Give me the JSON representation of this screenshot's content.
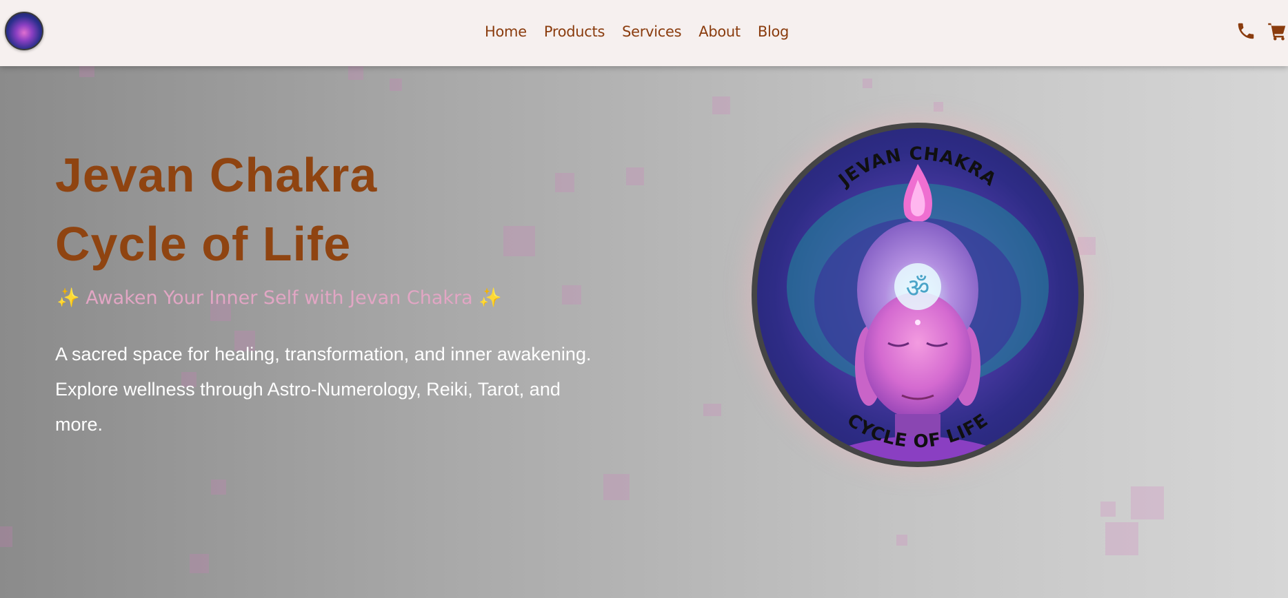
{
  "header": {
    "logo_icon": "jevan-chakra-logo",
    "nav": {
      "home": "Home",
      "products": "Products",
      "services": "Services",
      "about": "About",
      "blog": "Blog"
    },
    "phone_icon": "phone-icon",
    "cart_icon": "cart-icon",
    "accent_color": "#8a3c0e"
  },
  "hero": {
    "title_line1": "Jevan Chakra",
    "title_line2": "Cycle of Life",
    "tagline": "✨ Awaken Your Inner Self with Jevan Chakra ✨",
    "description_line1": "A sacred space for healing, transformation, and inner awakening.",
    "description_line2": "Explore wellness through Astro-Numerology, Reiki, Tarot, and more.",
    "emblem": {
      "top_text": "JEVAN CHAKRA",
      "bottom_text": "CYCLE OF LIFE",
      "symbol": "ॐ"
    }
  }
}
